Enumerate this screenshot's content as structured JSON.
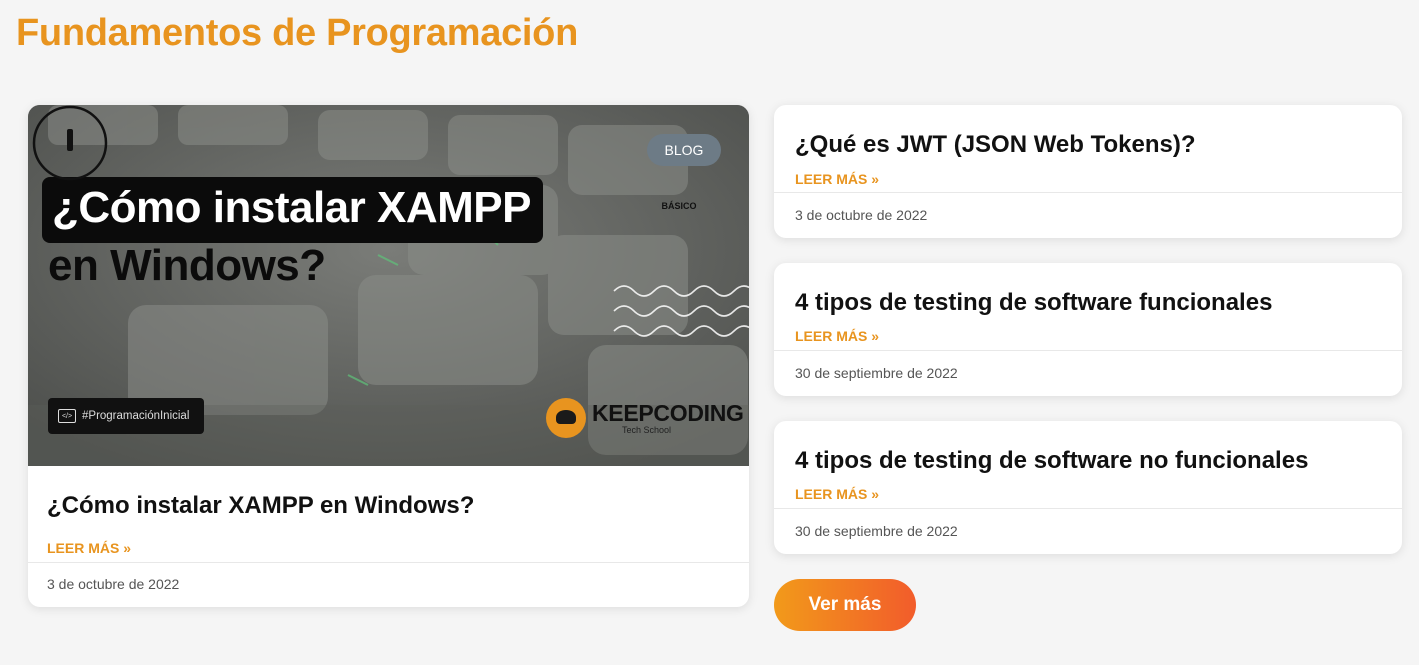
{
  "section": {
    "title": "Fundamentos de Programación"
  },
  "featured": {
    "thumbnail": {
      "headline_line1": "¿Cómo instalar XAMPP",
      "headline_line2": "en Windows?",
      "badge": "BLOG",
      "level": "BÁSICO",
      "hashtag": "#ProgramaciónInicial",
      "brand_name": "KEEPCODING",
      "brand_sub": "Tech School"
    },
    "title": "¿Cómo instalar XAMPP en Windows?",
    "read_more": "LEER MÁS »",
    "date": "3 de octubre de 2022"
  },
  "posts": [
    {
      "title": "¿Qué es JWT (JSON Web Tokens)?",
      "read_more": "LEER MÁS »",
      "date": "3 de octubre de 2022"
    },
    {
      "title": "4 tipos de testing de software funcionales",
      "read_more": "LEER MÁS »",
      "date": "30 de septiembre de 2022"
    },
    {
      "title": "4 tipos de testing de software no funcionales",
      "read_more": "LEER MÁS »",
      "date": "30 de septiembre de 2022"
    }
  ],
  "more_button": "Ver más",
  "colors": {
    "accent": "#e8941f",
    "badge": "#6d7b86",
    "button_start": "#f29a1a",
    "button_end": "#f25c2b"
  }
}
